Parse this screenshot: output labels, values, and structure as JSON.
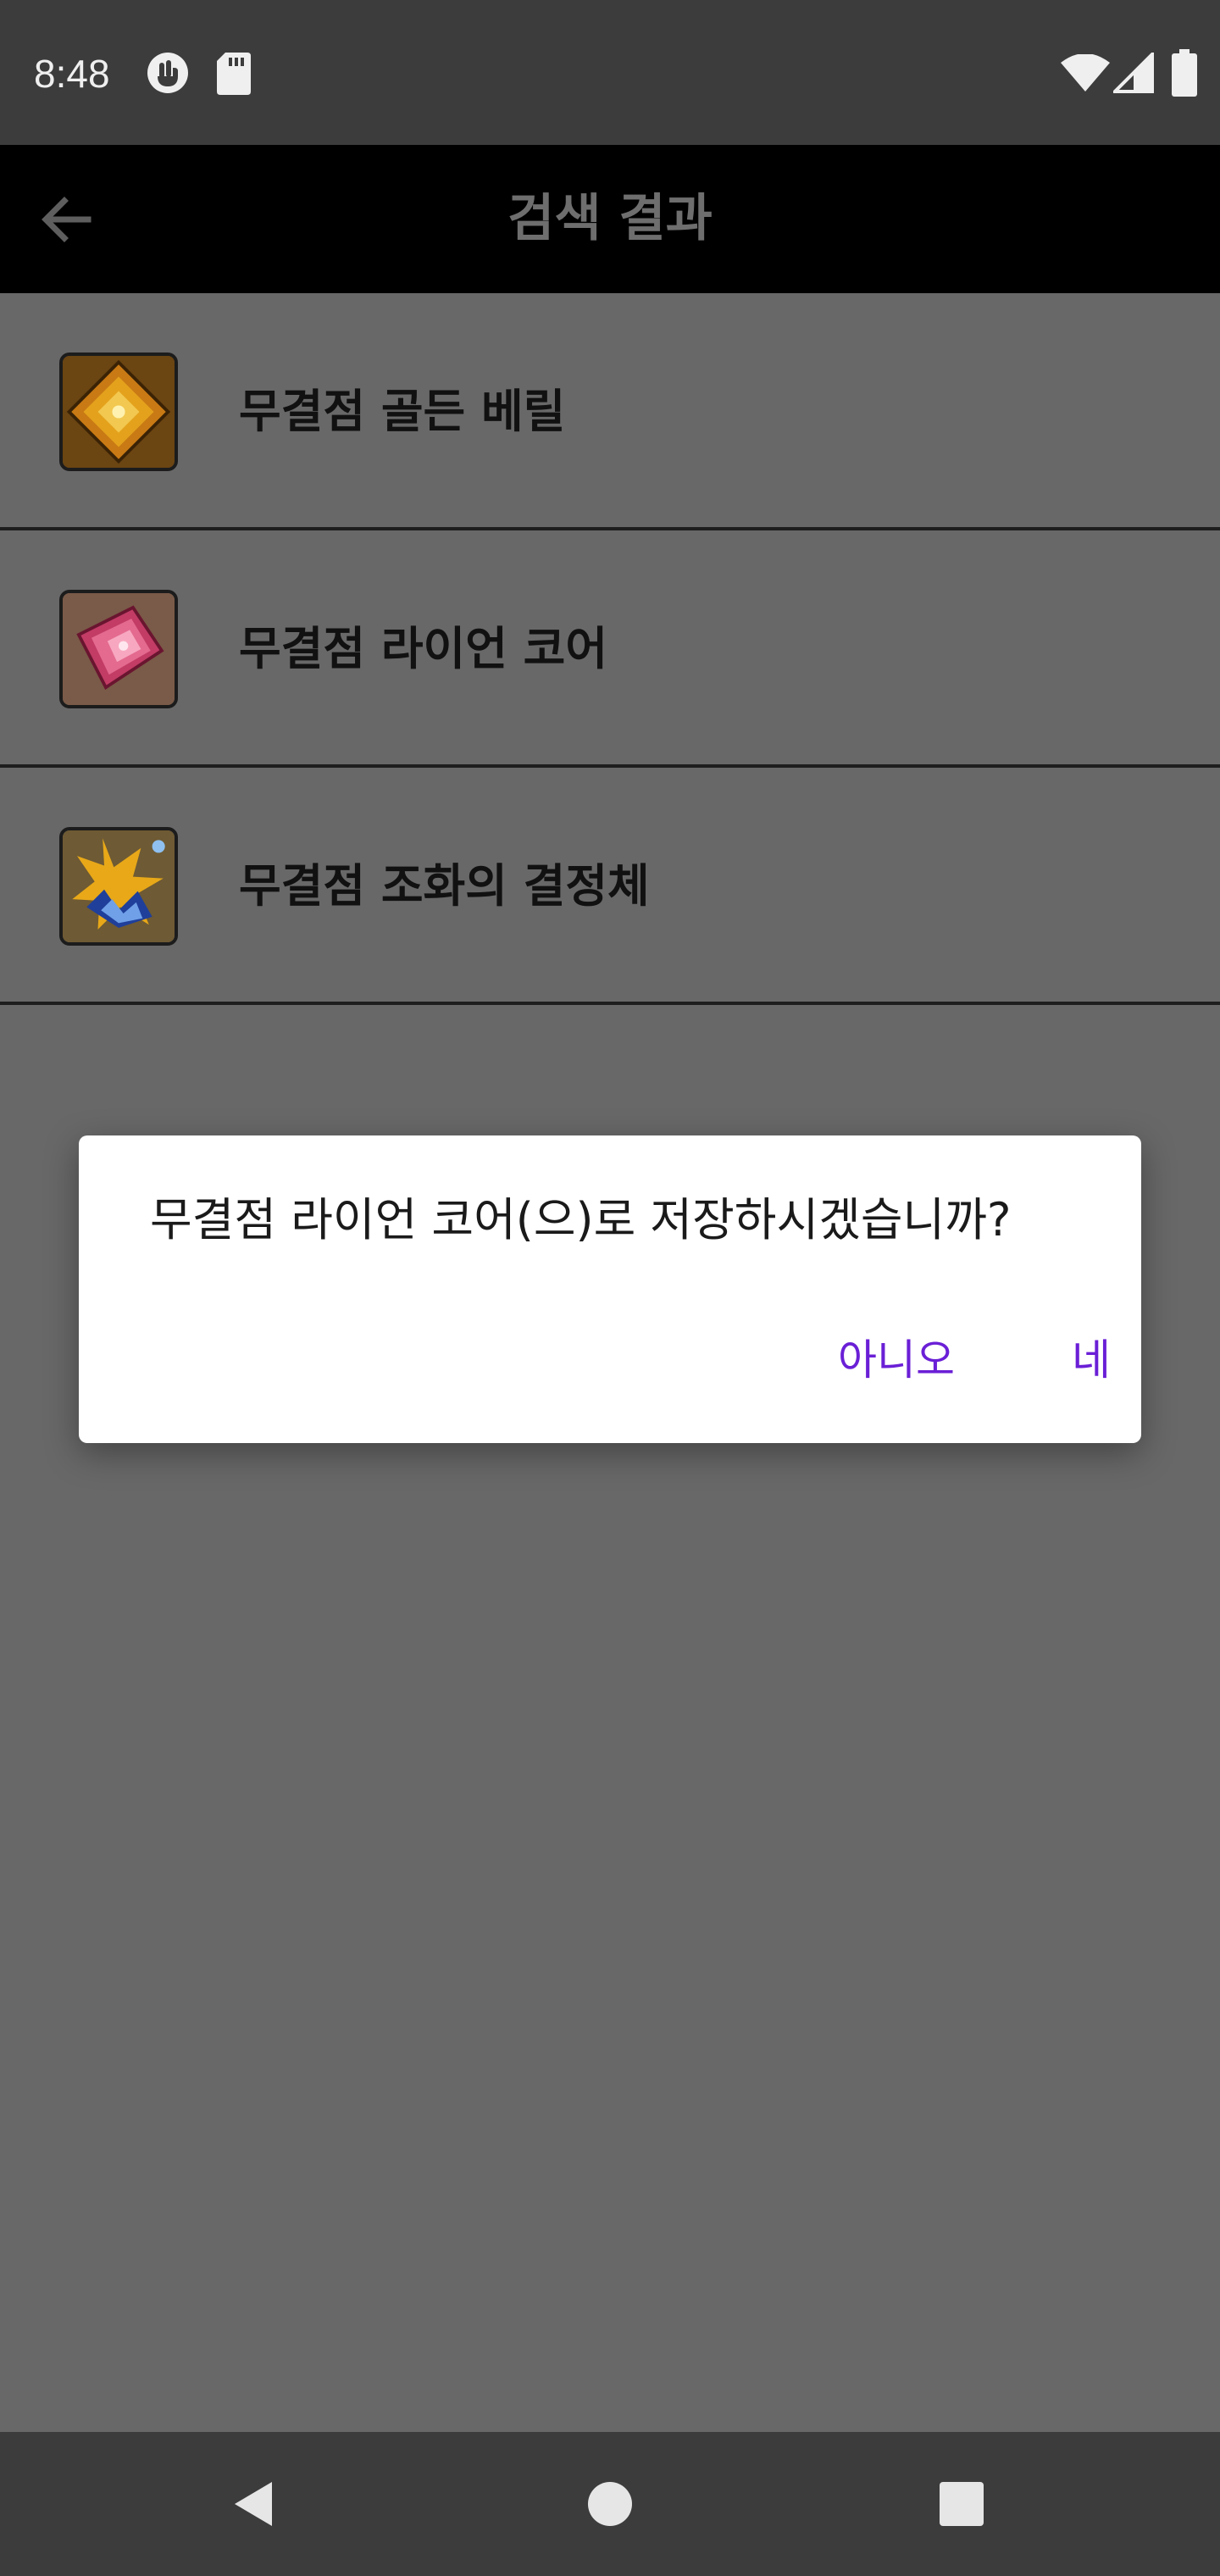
{
  "status_bar": {
    "time": "8:48",
    "icons": [
      "hand-icon",
      "sd-card-icon",
      "wifi-icon",
      "signal-icon",
      "battery-icon"
    ]
  },
  "app_bar": {
    "title": "검색 결과",
    "back_icon": "arrow-left-icon"
  },
  "results": [
    {
      "label": "무결점 골든 베릴",
      "icon": "golden-beryl-icon"
    },
    {
      "label": "무결점 라이언 코어",
      "icon": "lion-core-icon"
    },
    {
      "label": "무결점 조화의 결정체",
      "icon": "harmony-crystal-icon"
    }
  ],
  "dialog": {
    "message": "무결점 라이언 코어(으)로 저장하시겠습니까?",
    "no_label": "아니오",
    "yes_label": "네"
  },
  "nav_bar": {
    "icons": [
      "nav-back-icon",
      "nav-home-icon",
      "nav-recents-icon"
    ]
  },
  "colors": {
    "scrim_background": "#686868",
    "status_bar": "#3c3c3c",
    "app_bar": "#000000",
    "dialog_button": "#6a1fd6"
  }
}
